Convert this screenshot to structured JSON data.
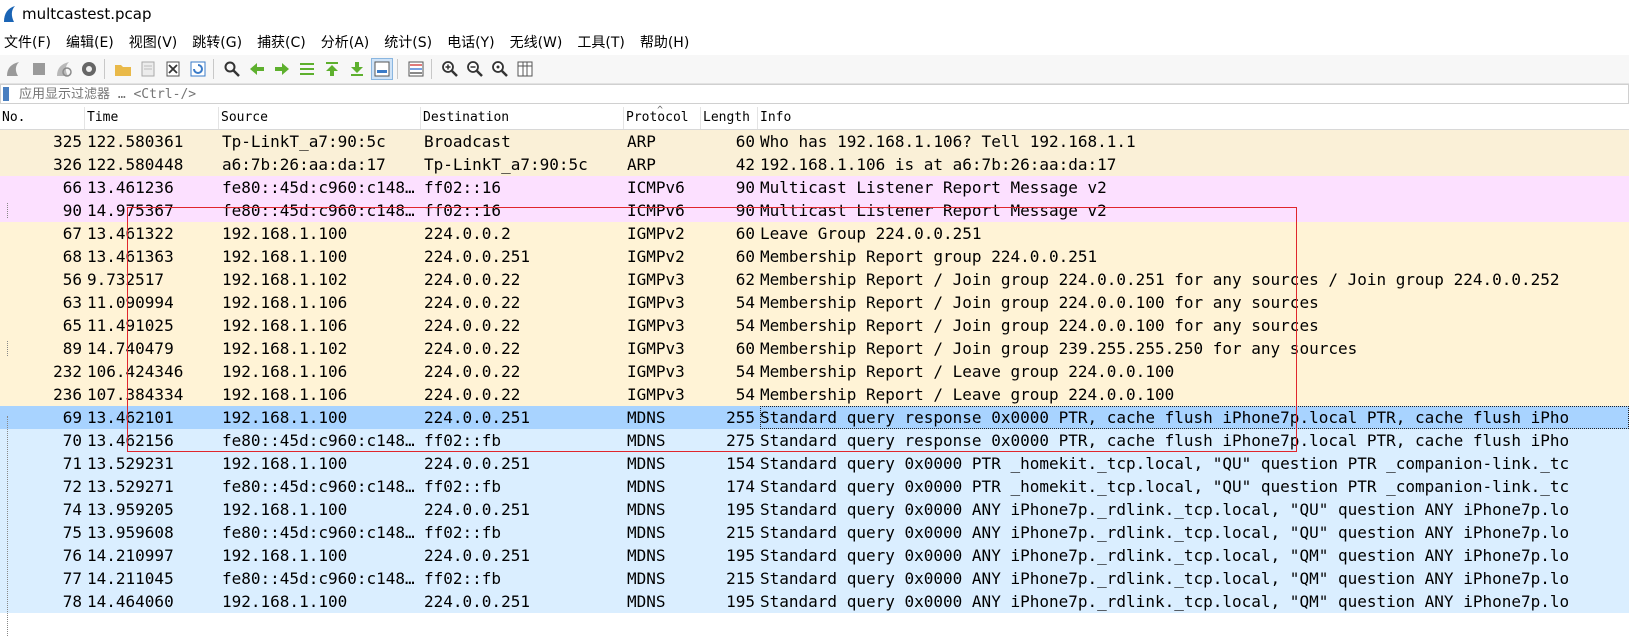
{
  "window": {
    "title": "multcastest.pcap"
  },
  "menu": [
    "文件(F)",
    "编辑(E)",
    "视图(V)",
    "跳转(G)",
    "捕获(C)",
    "分析(A)",
    "统计(S)",
    "电话(Y)",
    "无线(W)",
    "工具(T)",
    "帮助(H)"
  ],
  "toolbar": {
    "icons": [
      "start-capture-icon",
      "stop-capture-icon",
      "restart-capture-icon",
      "capture-options-icon",
      "open-file-icon",
      "save-file-icon",
      "close-file-icon",
      "reload-icon",
      "find-packet-icon",
      "go-back-icon",
      "go-forward-icon",
      "go-to-packet-icon",
      "go-first-icon",
      "go-last-icon",
      "auto-scroll-icon",
      "colorize-icon",
      "zoom-in-icon",
      "zoom-out-icon",
      "zoom-normal-icon",
      "resize-columns-icon"
    ]
  },
  "filter": {
    "placeholder": "应用显示过滤器 … <Ctrl-/>"
  },
  "columns": {
    "no": "No.",
    "time": "Time",
    "source": "Source",
    "destination": "Destination",
    "protocol": "Protocol",
    "length": "Length",
    "info": "Info"
  },
  "colors": {
    "arp": "#faf0d7",
    "icmpv6": "#fce0ff",
    "igmp": "#fff3d6",
    "mdns": "#daeeff",
    "selected": "#a8d3ff",
    "annotation_box": "#e0262c"
  },
  "packets": [
    {
      "no": "325",
      "time": "122.580361",
      "source": "Tp-LinkT_a7:90:5c",
      "destination": "Broadcast",
      "protocol": "ARP",
      "length": "60",
      "info": "Who has 192.168.1.106? Tell 192.168.1.1",
      "color": "arp"
    },
    {
      "no": "326",
      "time": "122.580448",
      "source": "a6:7b:26:aa:da:17",
      "destination": "Tp-LinkT_a7:90:5c",
      "protocol": "ARP",
      "length": "42",
      "info": "192.168.1.106 is at a6:7b:26:aa:da:17",
      "color": "arp"
    },
    {
      "no": "66",
      "time": "13.461236",
      "source": "fe80::45d:c960:c148…",
      "destination": "ff02::16",
      "protocol": "ICMPv6",
      "length": "90",
      "info": "Multicast Listener Report Message v2",
      "color": "icmpv6"
    },
    {
      "no": "90",
      "time": "14.975367",
      "source": "fe80::45d:c960:c148…",
      "destination": "ff02::16",
      "protocol": "ICMPv6",
      "length": "90",
      "info": "Multicast Listener Report Message v2",
      "color": "icmpv6"
    },
    {
      "no": "67",
      "time": "13.461322",
      "source": "192.168.1.100",
      "destination": "224.0.0.2",
      "protocol": "IGMPv2",
      "length": "60",
      "info": "Leave Group 224.0.0.251",
      "color": "igmp"
    },
    {
      "no": "68",
      "time": "13.461363",
      "source": "192.168.1.100",
      "destination": "224.0.0.251",
      "protocol": "IGMPv2",
      "length": "60",
      "info": "Membership Report group 224.0.0.251",
      "color": "igmp"
    },
    {
      "no": "56",
      "time": "9.732517",
      "source": "192.168.1.102",
      "destination": "224.0.0.22",
      "protocol": "IGMPv3",
      "length": "62",
      "info": "Membership Report / Join group 224.0.0.251 for any sources / Join group 224.0.0.252",
      "color": "igmp"
    },
    {
      "no": "63",
      "time": "11.090994",
      "source": "192.168.1.106",
      "destination": "224.0.0.22",
      "protocol": "IGMPv3",
      "length": "54",
      "info": "Membership Report / Join group 224.0.0.100 for any sources",
      "color": "igmp"
    },
    {
      "no": "65",
      "time": "11.491025",
      "source": "192.168.1.106",
      "destination": "224.0.0.22",
      "protocol": "IGMPv3",
      "length": "54",
      "info": "Membership Report / Join group 224.0.0.100 for any sources",
      "color": "igmp"
    },
    {
      "no": "89",
      "time": "14.740479",
      "source": "192.168.1.102",
      "destination": "224.0.0.22",
      "protocol": "IGMPv3",
      "length": "60",
      "info": "Membership Report / Join group 239.255.255.250 for any sources",
      "color": "igmp"
    },
    {
      "no": "232",
      "time": "106.424346",
      "source": "192.168.1.106",
      "destination": "224.0.0.22",
      "protocol": "IGMPv3",
      "length": "54",
      "info": "Membership Report / Leave group 224.0.0.100",
      "color": "igmp"
    },
    {
      "no": "236",
      "time": "107.384334",
      "source": "192.168.1.106",
      "destination": "224.0.0.22",
      "protocol": "IGMPv3",
      "length": "54",
      "info": "Membership Report / Leave group 224.0.0.100",
      "color": "igmp"
    },
    {
      "no": "69",
      "time": "13.462101",
      "source": "192.168.1.100",
      "destination": "224.0.0.251",
      "protocol": "MDNS",
      "length": "255",
      "info": "Standard query response 0x0000 PTR, cache flush iPhone7p.local PTR, cache flush iPho",
      "color": "selected",
      "selected": true
    },
    {
      "no": "70",
      "time": "13.462156",
      "source": "fe80::45d:c960:c148…",
      "destination": "ff02::fb",
      "protocol": "MDNS",
      "length": "275",
      "info": "Standard query response 0x0000 PTR, cache flush iPhone7p.local PTR, cache flush iPho",
      "color": "mdns"
    },
    {
      "no": "71",
      "time": "13.529231",
      "source": "192.168.1.100",
      "destination": "224.0.0.251",
      "protocol": "MDNS",
      "length": "154",
      "info": "Standard query 0x0000 PTR _homekit._tcp.local, \"QU\" question PTR _companion-link._tc",
      "color": "mdns"
    },
    {
      "no": "72",
      "time": "13.529271",
      "source": "fe80::45d:c960:c148…",
      "destination": "ff02::fb",
      "protocol": "MDNS",
      "length": "174",
      "info": "Standard query 0x0000 PTR _homekit._tcp.local, \"QU\" question PTR _companion-link._tc",
      "color": "mdns"
    },
    {
      "no": "74",
      "time": "13.959205",
      "source": "192.168.1.100",
      "destination": "224.0.0.251",
      "protocol": "MDNS",
      "length": "195",
      "info": "Standard query 0x0000 ANY iPhone7p._rdlink._tcp.local, \"QU\" question ANY iPhone7p.lo",
      "color": "mdns"
    },
    {
      "no": "75",
      "time": "13.959608",
      "source": "fe80::45d:c960:c148…",
      "destination": "ff02::fb",
      "protocol": "MDNS",
      "length": "215",
      "info": "Standard query 0x0000 ANY iPhone7p._rdlink._tcp.local, \"QU\" question ANY iPhone7p.lo",
      "color": "mdns"
    },
    {
      "no": "76",
      "time": "14.210997",
      "source": "192.168.1.100",
      "destination": "224.0.0.251",
      "protocol": "MDNS",
      "length": "195",
      "info": "Standard query 0x0000 ANY iPhone7p._rdlink._tcp.local, \"QM\" question ANY iPhone7p.lo",
      "color": "mdns"
    },
    {
      "no": "77",
      "time": "14.211045",
      "source": "fe80::45d:c960:c148…",
      "destination": "ff02::fb",
      "protocol": "MDNS",
      "length": "215",
      "info": "Standard query 0x0000 ANY iPhone7p._rdlink._tcp.local, \"QM\" question ANY iPhone7p.lo",
      "color": "mdns"
    },
    {
      "no": "78",
      "time": "14.464060",
      "source": "192.168.1.100",
      "destination": "224.0.0.251",
      "protocol": "MDNS",
      "length": "195",
      "info": "Standard query 0x0000 ANY iPhone7p._rdlink._tcp.local, \"QM\" question ANY iPhone7p.lo",
      "color": "mdns"
    }
  ]
}
